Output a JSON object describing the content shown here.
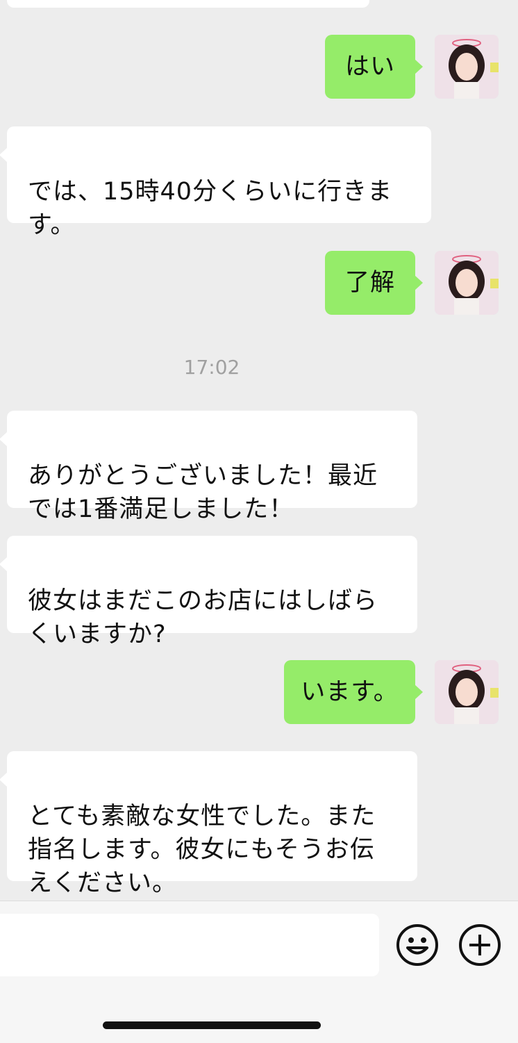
{
  "conversation": {
    "messages": [
      {
        "side": "out",
        "text": "はい"
      },
      {
        "side": "in",
        "text": "では、15時40分くらいに行きます。"
      },
      {
        "side": "out",
        "text": "了解"
      },
      {
        "side": "timestamp",
        "text": "17:02"
      },
      {
        "side": "in",
        "text": "ありがとうございました！最近では1番満足しました！"
      },
      {
        "side": "in",
        "text": "彼女はまだこのお店にはしばらくいますか?"
      },
      {
        "side": "out",
        "text": "います。"
      },
      {
        "side": "in",
        "text": "とても素敵な女性でした。また指名します。彼女にもそうお伝えください。"
      }
    ]
  },
  "input_bar": {
    "input_value": "",
    "icons": [
      "emoji-icon",
      "plus-icon"
    ]
  },
  "colors": {
    "background": "#ededed",
    "incoming_bubble": "#ffffff",
    "outgoing_bubble": "#95ec69",
    "timestamp": "#a0a0a0"
  }
}
